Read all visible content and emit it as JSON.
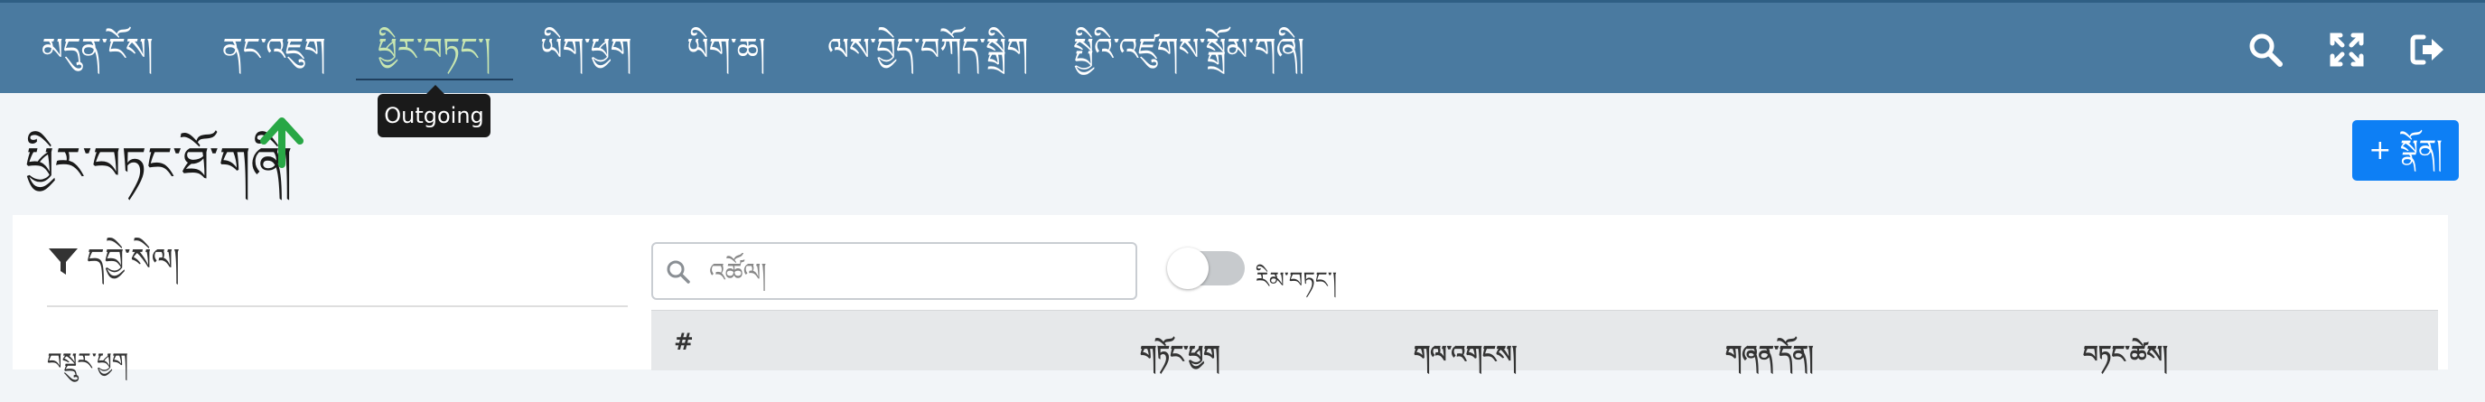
{
  "nav": {
    "items": [
      {
        "label": "མདུན་ངོས།"
      },
      {
        "label": "ནང་འཇུག"
      },
      {
        "label": "ཕྱིར་བཏང་།"
      },
      {
        "label": "ཡིག་ཕྱག"
      },
      {
        "label": "ཡིག་ཆ།"
      },
      {
        "label": "ལས་བྱེད་བཀོད་སྒྲིག"
      },
      {
        "label": "སྤྱིའི་འཛུགས་སྒྲོམ་གཞི།"
      }
    ],
    "active_index": 2,
    "tooltip": "Outgoing",
    "icons": [
      "search-icon",
      "expand-icon",
      "logout-icon"
    ]
  },
  "page": {
    "title": "ཕྱིར་བཏང་ཐོ་གཞི།",
    "title_icon": "arrow-up-icon",
    "add_button": "+ སྣོན།"
  },
  "filter": {
    "heading": "དབྱེ་སེལ།",
    "icon": "filter-icon",
    "field_label": "བསྡུར་ཕྱག"
  },
  "search": {
    "placeholder": "འཚོལ།"
  },
  "toggle": {
    "label": "རིམ་བཏང་།",
    "on": false
  },
  "table": {
    "columns": [
      "#",
      "གཏོང་ཕྱག",
      "གལ་འགངས།",
      "གཞན་དོན།",
      "བཏང་ཚེས།"
    ]
  },
  "colors": {
    "topbar": "#4a7aa0",
    "active_nav": "#c8e6b0",
    "accent_button": "#0d7ff5",
    "arrow_green": "#28a745"
  }
}
